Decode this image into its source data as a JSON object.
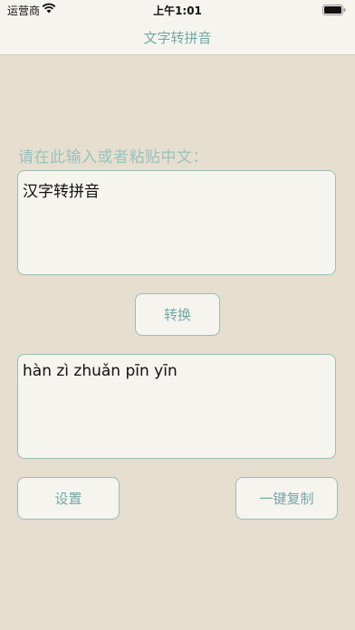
{
  "status_bar": {
    "carrier": "运营商",
    "time": "上午1:01",
    "icons": [
      "wifi-icon",
      "battery-icon"
    ]
  },
  "nav": {
    "title": "文字转拼音"
  },
  "main": {
    "prompt": "请在此输入或者粘贴中文：",
    "input_text": "汉字转拼音",
    "convert_label": "转换",
    "output_text": "hàn zì zhuǎn pīn yīn",
    "settings_label": "设置",
    "copy_label": "一键复制"
  },
  "colors": {
    "background": "#e6dece",
    "accent": "#74a8a4",
    "prompt_text": "#99c2be",
    "surface": "#f6f4ef",
    "border": "#9dbcb4"
  }
}
